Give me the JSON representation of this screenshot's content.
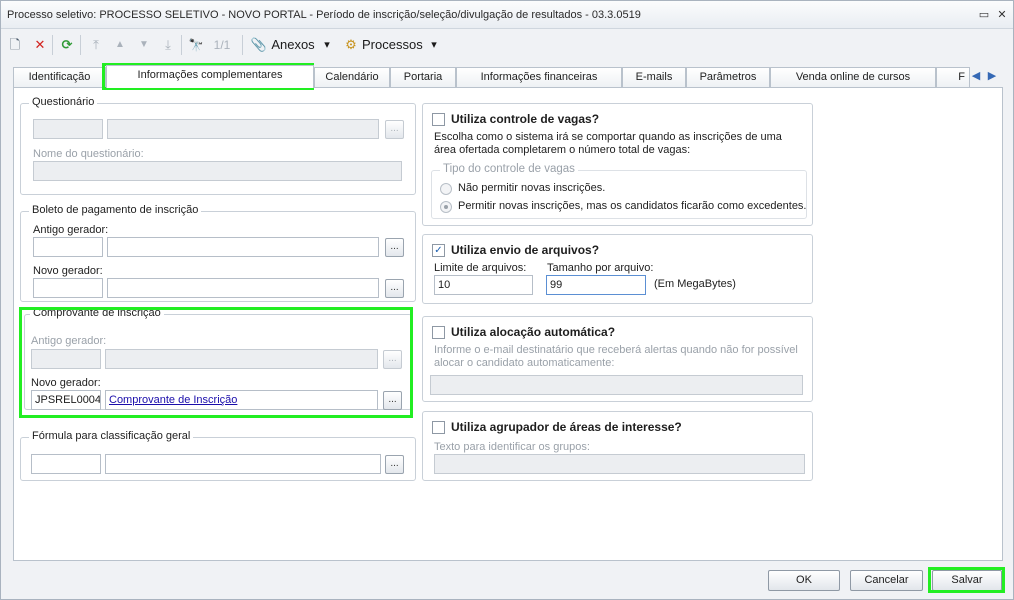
{
  "window": {
    "title": "Processo seletivo: PROCESSO SELETIVO - NOVO PORTAL - Período de inscrição/seleção/divulgação de resultados - 03.3.0519",
    "restore_glyph": "▭",
    "close_glyph": "✕"
  },
  "toolbar": {
    "new_icon": "🗋",
    "delete_icon": "✕",
    "refresh_icon": "⟳",
    "first_icon": "⤒",
    "prev_icon": "▲",
    "next_icon": "▼",
    "last_icon": "⤓",
    "binoculars_icon": "🔭",
    "record_counter": "1/1",
    "attachments_icon": "📎",
    "attachments_label": "Anexos",
    "dropdown_glyph": "▾",
    "processes_icon": "⚙",
    "processes_label": "Processos"
  },
  "tabs": [
    "Identificação",
    "Informações complementares",
    "Calendário",
    "Portaria",
    "Informações financeiras",
    "E-mails",
    "Parâmetros",
    "Venda online de cursos",
    "F"
  ],
  "tab_scroll": {
    "left": "◀",
    "right": "▶"
  },
  "questionario": {
    "title": "Questionário",
    "code": "",
    "description": "",
    "name_label": "Nome do questionário:",
    "name_value": ""
  },
  "boleto": {
    "title": "Boleto de pagamento de inscrição",
    "antigo_label": "Antigo gerador:",
    "antigo_code": "",
    "antigo_desc": "",
    "novo_label": "Novo gerador:",
    "novo_code": "",
    "novo_desc": ""
  },
  "comprovante": {
    "title": "Comprovante de inscrição",
    "antigo_label": "Antigo gerador:",
    "antigo_code": "",
    "antigo_desc": "",
    "novo_label": "Novo gerador:",
    "novo_code": "JPSREL0004",
    "novo_desc": "Comprovante de Inscrição"
  },
  "formula": {
    "title": "Fórmula para classificação geral",
    "code": "",
    "desc": ""
  },
  "ellipsis": "...",
  "vagas": {
    "checkbox_label": "Utiliza controle de vagas?",
    "description": "Escolha como o sistema irá se comportar quando as inscrições de uma área ofertada completarem o número total de vagas:",
    "group_title": "Tipo do controle de vagas",
    "option1": "Não permitir novas inscrições.",
    "option2": "Permitir novas inscrições, mas os candidatos ficarão como excedentes."
  },
  "arquivos": {
    "checkbox_label": "Utiliza envio de arquivos?",
    "checked_glyph": "✓",
    "limite_label": "Limite de arquivos:",
    "limite_value": "10",
    "tamanho_label": "Tamanho por arquivo:",
    "tamanho_value": "99",
    "unit_label": "(Em MegaBytes)"
  },
  "alocacao": {
    "checkbox_label": "Utiliza alocação automática?",
    "description": "Informe o e-mail destinatário que receberá alertas quando não for possível alocar o candidato automaticamente:",
    "email_value": ""
  },
  "agrupador": {
    "checkbox_label": "Utiliza agrupador de áreas de interesse?",
    "text_label": "Texto para identificar os grupos:",
    "text_value": ""
  },
  "footer": {
    "ok_label": "OK",
    "cancel_label": "Cancelar",
    "save_label": "Salvar"
  },
  "colors": {
    "highlight": "#22ee22",
    "link": "#1a0dab",
    "checkmark": "#1c5fb0"
  }
}
